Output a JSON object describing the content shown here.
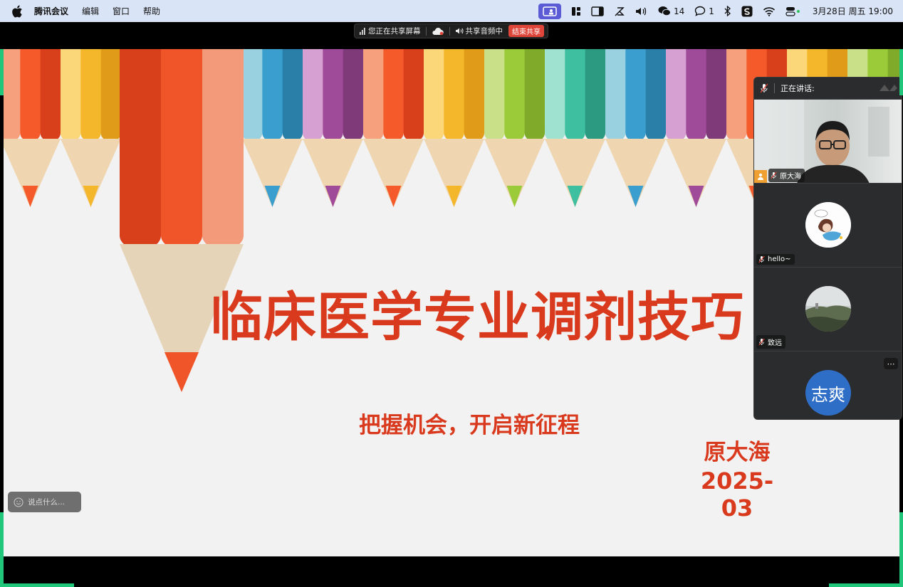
{
  "menubar": {
    "app_name": "腾讯会议",
    "menus": [
      "编辑",
      "窗口",
      "帮助"
    ],
    "wechat_count": "14",
    "chat_count": "1",
    "datetime": "3月28日 周五  19:00"
  },
  "share_bar": {
    "sharing_label": "您正在共享屏幕",
    "audio_label": "共享音频中",
    "stop_label": "结束共享"
  },
  "slide": {
    "title": "临床医学专业调剂技巧",
    "subtitle": "把握机会，开启新征程",
    "author": "原大海",
    "date": "2025-03"
  },
  "chat": {
    "placeholder": "说点什么..."
  },
  "panel": {
    "header": "正在讲话:",
    "participants": [
      {
        "name": "原大海",
        "host": true,
        "video": true
      },
      {
        "name": "hello~",
        "host": false,
        "video": false
      },
      {
        "name": "致远",
        "host": false,
        "video": false
      },
      {
        "name": "",
        "avatar_text": "志爽",
        "host": false,
        "video": false
      }
    ]
  },
  "colors": {
    "accent_red": "#d9391c",
    "frame_green": "#20c77a",
    "stop_red": "#e0453a",
    "avatar_blue": "#2f6ec7"
  }
}
